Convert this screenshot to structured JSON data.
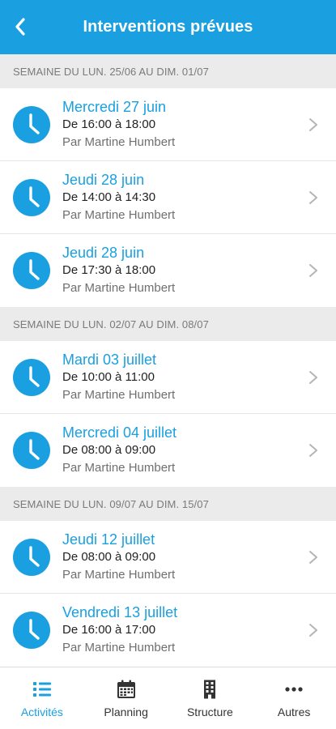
{
  "header": {
    "title": "Interventions prévues"
  },
  "colors": {
    "accent": "#1aa0e1",
    "week_header_bg": "#ebebeb"
  },
  "weeks": [
    {
      "label": "SEMAINE DU LUN. 25/06 AU DIM. 01/07",
      "items": [
        {
          "date": "Mercredi 27 juin",
          "time": "De 16:00 à 18:00",
          "by": "Par Martine Humbert"
        },
        {
          "date": "Jeudi 28 juin",
          "time": "De 14:00 à 14:30",
          "by": "Par Martine Humbert"
        },
        {
          "date": "Jeudi 28 juin",
          "time": "De 17:30 à 18:00",
          "by": "Par Martine Humbert"
        }
      ]
    },
    {
      "label": "SEMAINE DU LUN. 02/07 AU DIM. 08/07",
      "items": [
        {
          "date": "Mardi 03 juillet",
          "time": "De 10:00 à 11:00",
          "by": "Par Martine Humbert"
        },
        {
          "date": "Mercredi 04 juillet",
          "time": "De 08:00 à 09:00",
          "by": "Par Martine Humbert"
        }
      ]
    },
    {
      "label": "SEMAINE DU LUN. 09/07 AU DIM. 15/07",
      "items": [
        {
          "date": "Jeudi 12 juillet",
          "time": "De 08:00 à 09:00",
          "by": "Par Martine Humbert"
        },
        {
          "date": "Vendredi 13 juillet",
          "time": "De 16:00 à 17:00",
          "by": "Par Martine Humbert"
        }
      ]
    }
  ],
  "tabs": [
    {
      "label": "Activités",
      "icon": "list-icon",
      "active": true
    },
    {
      "label": "Planning",
      "icon": "calendar-icon",
      "active": false
    },
    {
      "label": "Structure",
      "icon": "building-icon",
      "active": false
    },
    {
      "label": "Autres",
      "icon": "more-icon",
      "active": false
    }
  ]
}
